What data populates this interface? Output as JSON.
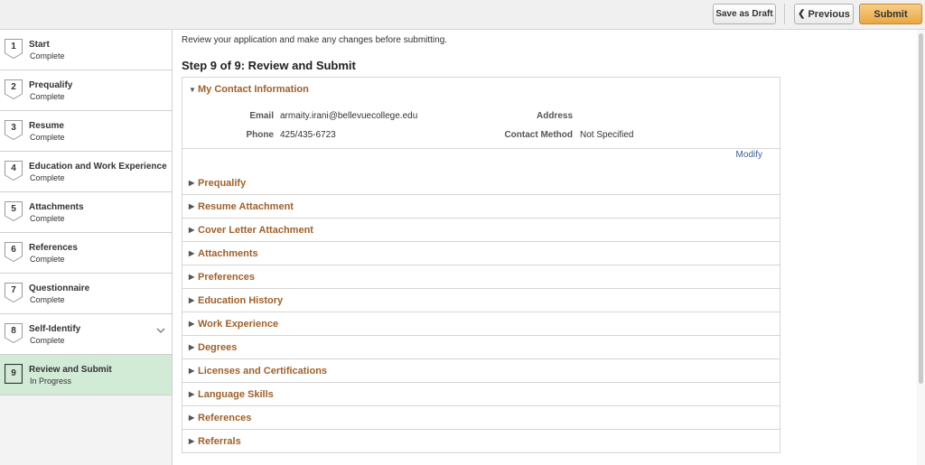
{
  "toolbar": {
    "save_draft_label": "Save as Draft",
    "previous_label": "Previous",
    "submit_label": "Submit"
  },
  "steps": [
    {
      "number": "1",
      "title": "Start",
      "status": "Complete"
    },
    {
      "number": "2",
      "title": "Prequalify",
      "status": "Complete"
    },
    {
      "number": "3",
      "title": "Resume",
      "status": "Complete"
    },
    {
      "number": "4",
      "title": "Education and Work Experience",
      "status": "Complete"
    },
    {
      "number": "5",
      "title": "Attachments",
      "status": "Complete"
    },
    {
      "number": "6",
      "title": "References",
      "status": "Complete"
    },
    {
      "number": "7",
      "title": "Questionnaire",
      "status": "Complete"
    },
    {
      "number": "8",
      "title": "Self-Identify",
      "status": "Complete"
    },
    {
      "number": "9",
      "title": "Review and Submit",
      "status": "In Progress"
    }
  ],
  "main": {
    "intro": "Review your application and make any changes before submitting.",
    "heading": "Step 9 of 9: Review and Submit",
    "contact": {
      "title": "My Contact Information",
      "email_label": "Email",
      "email_value": "armaity.irani@bellevuecollege.edu",
      "address_label": "Address",
      "phone_label": "Phone",
      "phone_value": "425/435-6723",
      "method_label": "Contact Method",
      "method_value": "Not Specified",
      "modify_label": "Modify"
    },
    "sections": [
      "Prequalify",
      "Resume Attachment",
      "Cover Letter Attachment",
      "Attachments",
      "Preferences",
      "Education History",
      "Work Experience",
      "Degrees",
      "Licenses and Certifications",
      "Language Skills",
      "References",
      "Referrals"
    ]
  },
  "colors": {
    "accent": "#a0602a",
    "active_step": "#d2ebd7",
    "submit": "#e9a73f",
    "link": "#3b5b9a"
  }
}
